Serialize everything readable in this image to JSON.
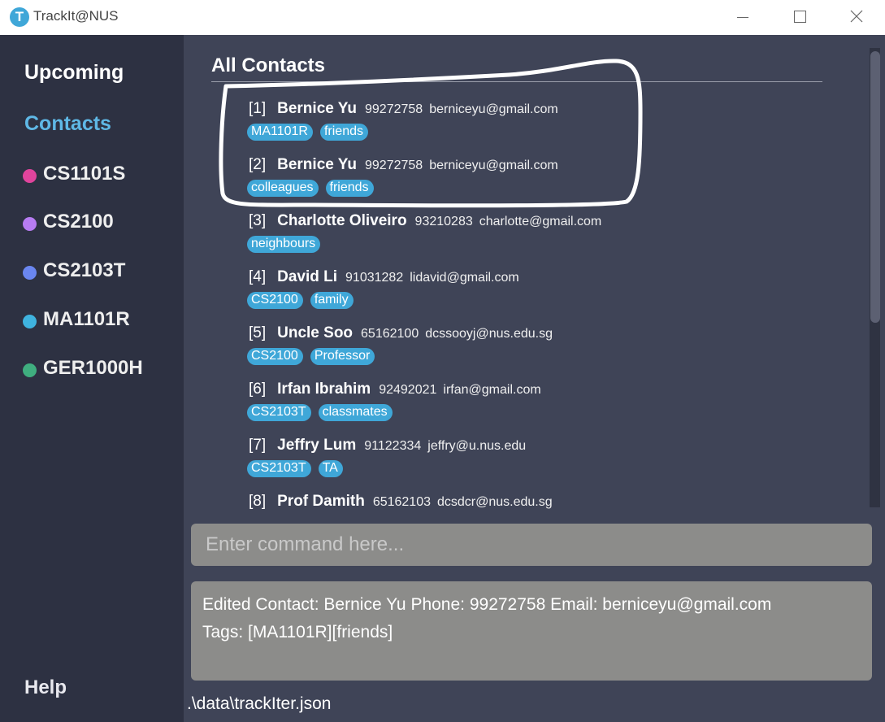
{
  "window": {
    "title": "TrackIt@NUS",
    "app_icon_letter": "T"
  },
  "sidebar": {
    "upcoming": "Upcoming",
    "contacts": "Contacts",
    "help": "Help",
    "modules": [
      {
        "label": "CS1101S",
        "color": "#e0449c"
      },
      {
        "label": "CS2100",
        "color": "#b77cf2"
      },
      {
        "label": "CS2103T",
        "color": "#6a86f0"
      },
      {
        "label": "MA1101R",
        "color": "#3fb3df"
      },
      {
        "label": "GER1000H",
        "color": "#3fae7f"
      }
    ]
  },
  "main": {
    "heading": "All Contacts",
    "contacts": [
      {
        "index": "[1]",
        "name": "Bernice Yu",
        "phone": "99272758",
        "email": "berniceyu@gmail.com",
        "tags": [
          "MA1101R",
          "friends"
        ]
      },
      {
        "index": "[2]",
        "name": "Bernice Yu",
        "phone": "99272758",
        "email": "berniceyu@gmail.com",
        "tags": [
          "colleagues",
          "friends"
        ]
      },
      {
        "index": "[3]",
        "name": "Charlotte Oliveiro",
        "phone": "93210283",
        "email": "charlotte@gmail.com",
        "tags": [
          "neighbours"
        ]
      },
      {
        "index": "[4]",
        "name": "David Li",
        "phone": "91031282",
        "email": "lidavid@gmail.com",
        "tags": [
          "CS2100",
          "family"
        ]
      },
      {
        "index": "[5]",
        "name": "Uncle Soo",
        "phone": "65162100",
        "email": "dcssooyj@nus.edu.sg",
        "tags": [
          "CS2100",
          "Professor"
        ]
      },
      {
        "index": "[6]",
        "name": "Irfan Ibrahim",
        "phone": "92492021",
        "email": "irfan@gmail.com",
        "tags": [
          "CS2103T",
          "classmates"
        ]
      },
      {
        "index": "[7]",
        "name": "Jeffry Lum",
        "phone": "91122334",
        "email": "jeffry@u.nus.edu",
        "tags": [
          "CS2103T",
          "TA"
        ]
      },
      {
        "index": "[8]",
        "name": "Prof Damith",
        "phone": "65162103",
        "email": "dcsdcr@nus.edu.sg",
        "tags": [
          "",
          ""
        ]
      }
    ]
  },
  "command": {
    "placeholder": "Enter command here..."
  },
  "result": {
    "line1": "Edited Contact: Bernice Yu Phone: 99272758 Email: berniceyu@gmail.com",
    "line2": "Tags: [MA1101R][friends]"
  },
  "status": {
    "file_path": ".\\data\\trackIter.json"
  },
  "colors": {
    "sidebar_bg": "#2d3142",
    "main_bg": "#3f4457",
    "accent": "#5fb8e6",
    "tag_bg": "#3fa7d8",
    "input_bg": "#8c8c8a"
  }
}
